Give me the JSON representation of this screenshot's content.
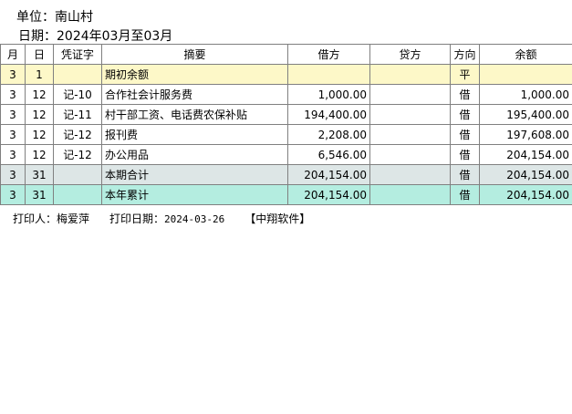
{
  "header": {
    "unit_text": "单位：南山村",
    "date_text": "日期：2024年03月至03月"
  },
  "table": {
    "columns": [
      "月",
      "日",
      "凭证字",
      "摘要",
      "借方",
      "贷方",
      "方向",
      "余额"
    ],
    "rows": [
      {
        "month": "3",
        "day": "1",
        "voucher": "",
        "summary": "期初余额",
        "debit": "",
        "credit": "",
        "direction": "平",
        "balance": ""
      },
      {
        "month": "3",
        "day": "12",
        "voucher": "记-10",
        "summary": "合作社会计服务费",
        "debit": "1,000.00",
        "credit": "",
        "direction": "借",
        "balance": "1,000.00"
      },
      {
        "month": "3",
        "day": "12",
        "voucher": "记-11",
        "summary": "村干部工资、电话费农保补贴",
        "debit": "194,400.00",
        "credit": "",
        "direction": "借",
        "balance": "195,400.00"
      },
      {
        "month": "3",
        "day": "12",
        "voucher": "记-12",
        "summary": "报刊费",
        "debit": "2,208.00",
        "credit": "",
        "direction": "借",
        "balance": "197,608.00"
      },
      {
        "month": "3",
        "day": "12",
        "voucher": "记-12",
        "summary": "办公用品",
        "debit": "6,546.00",
        "credit": "",
        "direction": "借",
        "balance": "204,154.00"
      },
      {
        "month": "3",
        "day": "31",
        "voucher": "",
        "summary": "本期合计",
        "debit": "204,154.00",
        "credit": "",
        "direction": "借",
        "balance": "204,154.00"
      },
      {
        "month": "3",
        "day": "31",
        "voucher": "",
        "summary": "本年累计",
        "debit": "204,154.00",
        "credit": "",
        "direction": "借",
        "balance": "204,154.00"
      }
    ]
  },
  "footer": {
    "printer_label": "打印人：梅爱萍",
    "print_date_label": "打印日期：",
    "print_date_value": "2024-03-26",
    "software": "【中翔软件】"
  },
  "colors": {
    "opening_row": "#fdf8c8",
    "period_total_row": "#dde6e6",
    "year_total_row": "#b4ede0"
  }
}
